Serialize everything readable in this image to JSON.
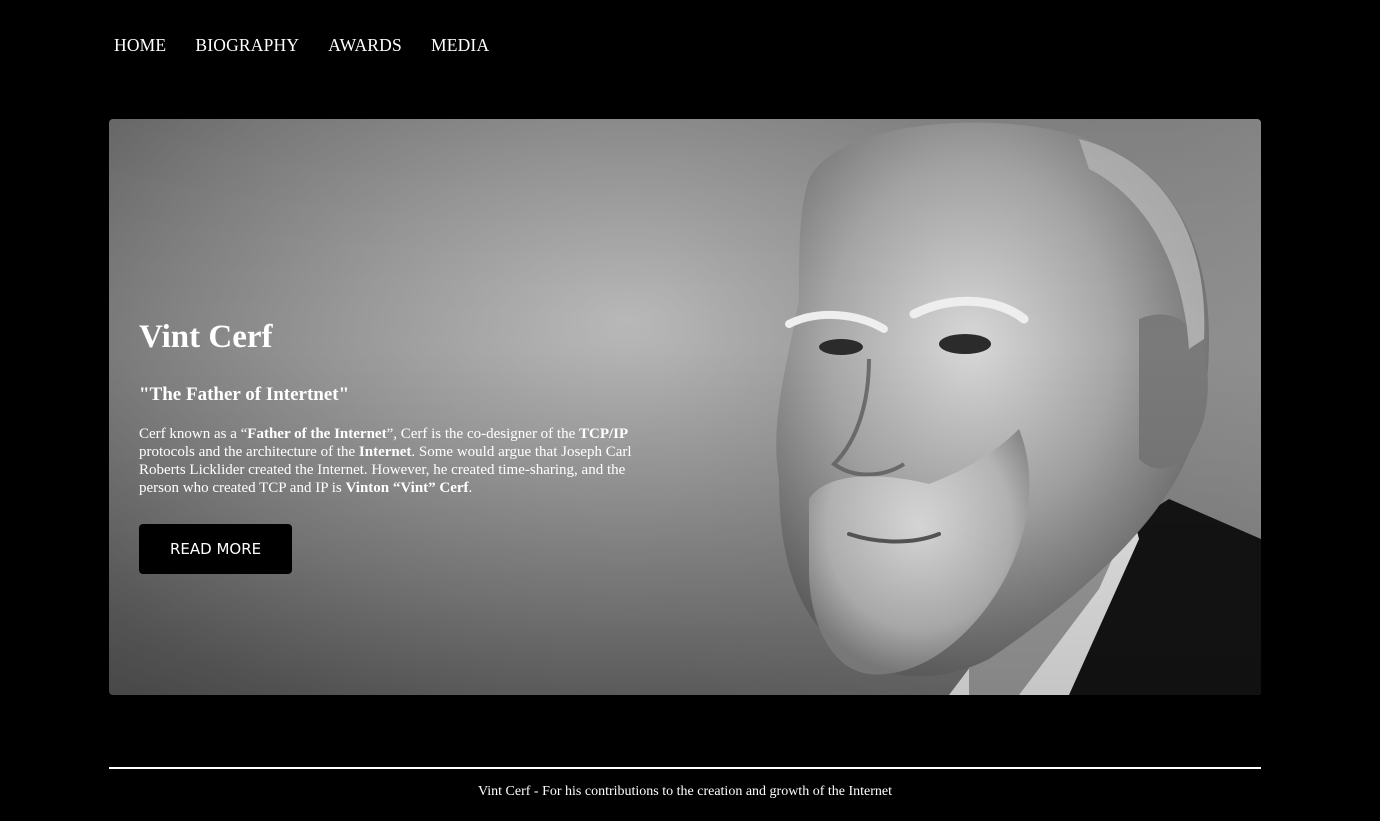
{
  "nav": {
    "items": [
      {
        "label": "HOME"
      },
      {
        "label": "BIOGRAPHY"
      },
      {
        "label": "AWARDS"
      },
      {
        "label": "MEDIA"
      }
    ]
  },
  "hero": {
    "title": "Vint Cerf",
    "subtitle": "\"The Father of Intertnet\"",
    "text": {
      "p1": "Cerf known as a “",
      "b1": "Father of the Internet",
      "p2": "”, Cerf is the co-designer of the ",
      "b2": "TCP/IP",
      "p3": " protocols and the architecture of the ",
      "b3": "Internet",
      "p4": ". Some would argue that Joseph Carl Roberts Licklider created the Internet. However, he created time-sharing, and the person who created TCP and IP is ",
      "b4": "Vinton “Vint” Cerf",
      "p5": "."
    },
    "button_label": "READ MORE",
    "image": "portrait-photo"
  },
  "footer": {
    "text": "Vint Cerf - For his contributions to the creation and growth of the Internet"
  },
  "colors": {
    "background": "#000000",
    "text": "#ffffff",
    "button": "#000000"
  }
}
